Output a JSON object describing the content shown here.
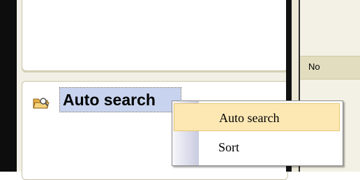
{
  "right_pane": {
    "header_text": "No"
  },
  "sidebar": {
    "selected_item": {
      "label": "Auto search",
      "icon": "folder-search-icon"
    }
  },
  "context_menu": {
    "items": [
      {
        "label": "Auto search",
        "highlighted": true
      },
      {
        "label": "Sort",
        "highlighted": false
      }
    ]
  },
  "colors": {
    "selection_bg": "#c8d4ef",
    "menu_highlight": "#fde8b4",
    "header_bg": "#e3ddbf"
  }
}
